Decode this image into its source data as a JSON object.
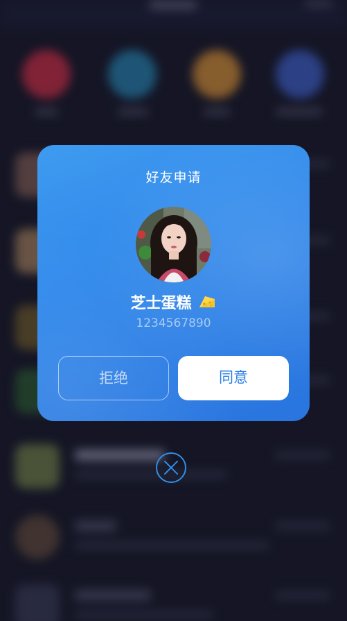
{
  "dialog": {
    "title": "好友申请",
    "user_name": "芝士蛋糕",
    "user_name_emoji_icon": "cheese-icon",
    "user_id": "1234567890",
    "reject_label": "拒绝",
    "accept_label": "同意"
  },
  "close": {
    "icon": "close-icon"
  },
  "colors": {
    "dialog_gradient_start": "#3f9bf0",
    "dialog_gradient_end": "#2a74de",
    "accept_text": "#2b7fe6",
    "close_ring": "#2f8fe8",
    "background": "#1c1d2d"
  }
}
